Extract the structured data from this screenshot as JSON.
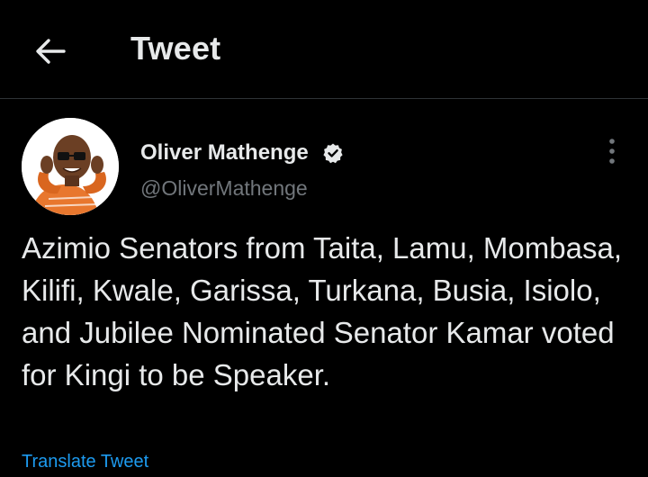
{
  "header": {
    "title": "Tweet",
    "back_icon": "arrow-left-icon"
  },
  "tweet": {
    "author": {
      "name": "Oliver Mathenge",
      "handle": "@OliverMathenge",
      "verified": true,
      "verified_icon": "verified-badge-icon"
    },
    "more_icon": "more-vertical-icon",
    "text": "Azimio Senators from Taita, Lamu, Mombasa, Kilifi, Kwale, Garissa, Turkana, Busia, Isiolo, and Jubilee Nominated Senator Kamar voted for Kingi to be Speaker.",
    "translate_label": "Translate Tweet"
  },
  "colors": {
    "background": "#000000",
    "text_primary": "#e7e9ea",
    "text_secondary": "#71767b",
    "link": "#1d9bf0",
    "divider": "#2f3336"
  }
}
